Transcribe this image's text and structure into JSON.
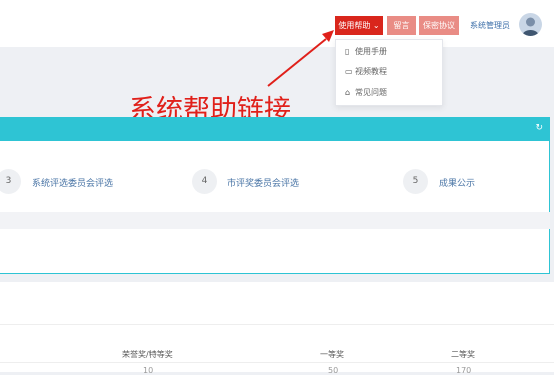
{
  "header": {
    "help_button": "使用帮助 ⌄",
    "message_button": "留言",
    "agreement_button": "保密协议",
    "user_name": "系统管理员"
  },
  "help_menu": {
    "items": [
      {
        "icon": "book-icon",
        "label": "使用手册"
      },
      {
        "icon": "video-icon",
        "label": "视频教程"
      },
      {
        "icon": "graduation-cap-icon",
        "label": "常见问题"
      }
    ]
  },
  "annotation": {
    "text": "系统帮助链接",
    "color": "#e0201a"
  },
  "progress_panel": {
    "accent_color": "#2ec4d4",
    "steps": [
      {
        "number": "3",
        "label": "系统评选委员会评选"
      },
      {
        "number": "4",
        "label": "市评奖委员会评选"
      },
      {
        "number": "5",
        "label": "成果公示"
      }
    ]
  },
  "table": {
    "headers": [
      "荣誉奖/特等奖",
      "一等奖",
      "二等奖"
    ],
    "row_values": [
      "10",
      "50",
      "170"
    ]
  }
}
